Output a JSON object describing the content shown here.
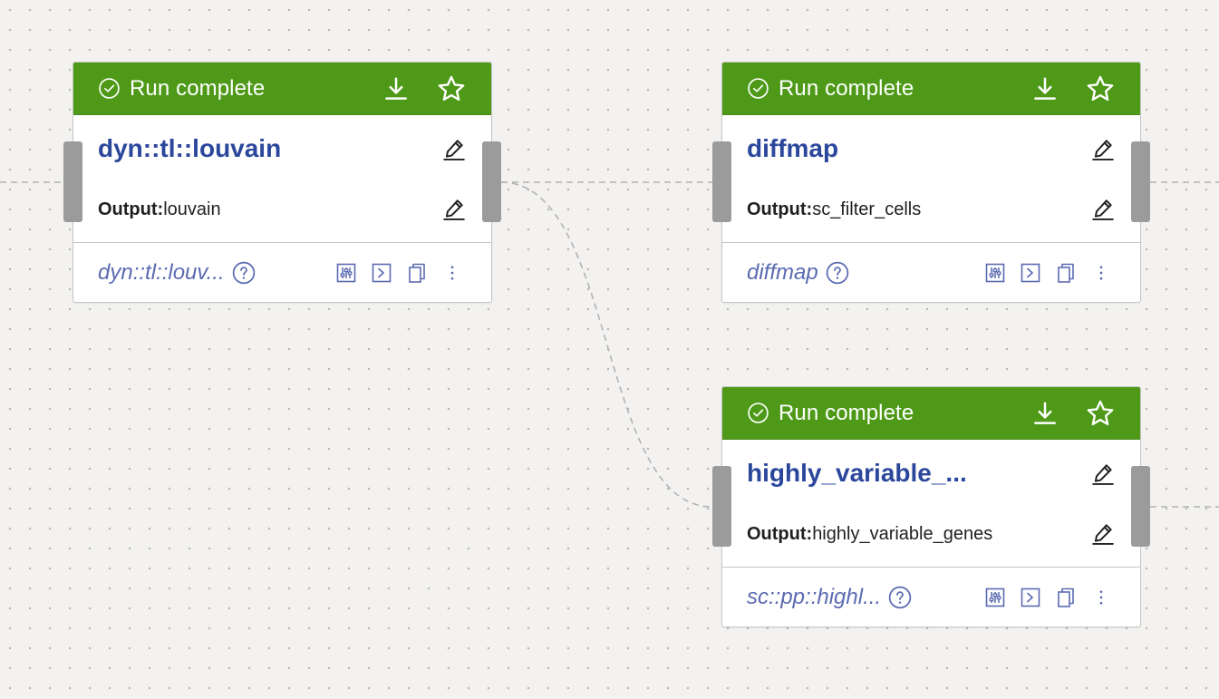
{
  "canvas": {
    "background_color": "#f3f2f1",
    "edge_color": "#b3b3b3"
  },
  "theme": {
    "header_green": "#4e9a18",
    "title_blue": "#2b479c",
    "muted_blue": "#5b6ab1",
    "port_gray": "#9b9b9b"
  },
  "nodes": [
    {
      "status_text": "Run complete",
      "status_icon": "check-circle-icon",
      "title": "dyn::tl::louvain",
      "output_label": "Output:",
      "output_value": "louvain",
      "function_name": "dyn::tl::louv...",
      "header_actions": [
        "download-icon",
        "star-icon"
      ],
      "footer_actions": [
        "sliders-icon",
        "terminal-icon",
        "copy-icon",
        "more-vertical-icon"
      ]
    },
    {
      "status_text": "Run complete",
      "status_icon": "check-circle-icon",
      "title": "diffmap",
      "output_label": "Output:",
      "output_value": "sc_filter_cells",
      "function_name": "diffmap",
      "header_actions": [
        "download-icon",
        "star-icon"
      ],
      "footer_actions": [
        "sliders-icon",
        "terminal-icon",
        "copy-icon",
        "more-vertical-icon"
      ]
    },
    {
      "status_text": "Run complete",
      "status_icon": "check-circle-icon",
      "title": "highly_variable_...",
      "output_label": "Output:",
      "output_value": "highly_variable_genes",
      "function_name": "sc::pp::highl...",
      "header_actions": [
        "download-icon",
        "star-icon"
      ],
      "footer_actions": [
        "sliders-icon",
        "terminal-icon",
        "copy-icon",
        "more-vertical-icon"
      ]
    }
  ]
}
